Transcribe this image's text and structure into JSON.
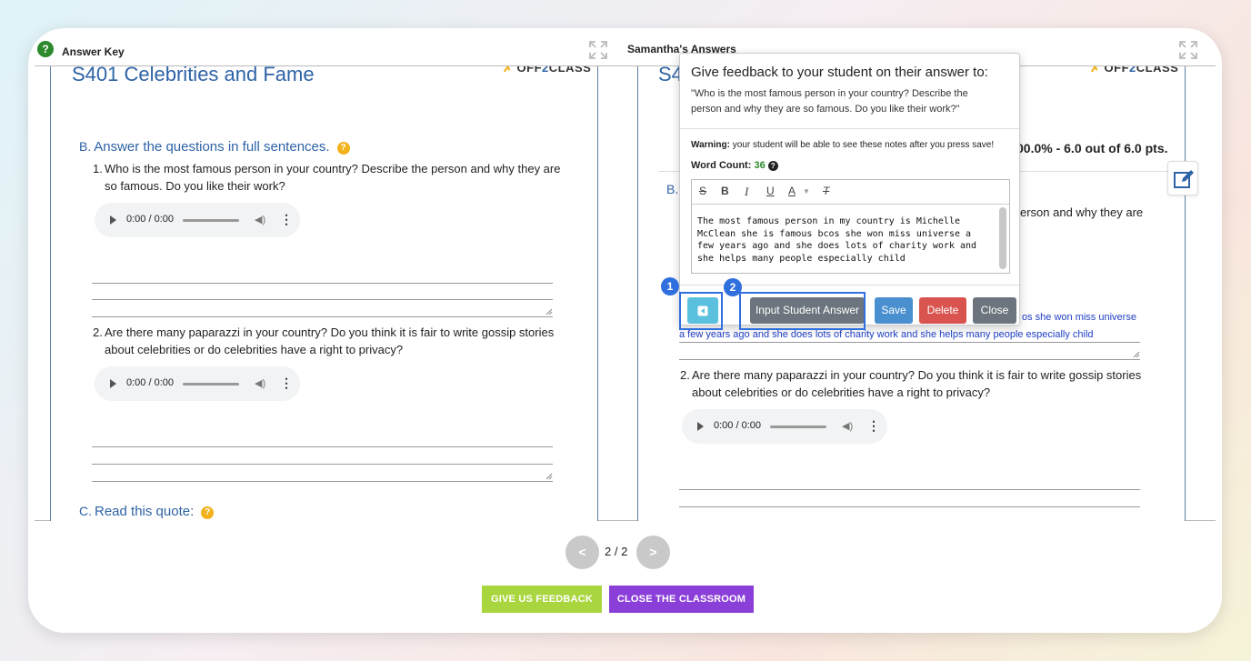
{
  "left_panel": {
    "header": "Answer Key",
    "help_icon": "?",
    "title": "S401 Celebrities and Fame",
    "logo": {
      "star": "✗",
      "text_a": "OFF",
      "text_b": "2",
      "text_c": "CLASS"
    },
    "section_b": {
      "letter": "B.",
      "label": "Answer the questions in full sentences.",
      "help": "?"
    },
    "q1": {
      "num": "1.",
      "line1": "Who is the most famous person in your country? Describe the person and why they are",
      "line2": "so famous. Do you like their work?"
    },
    "q2": {
      "num": "2.",
      "line1": "Are there many paparazzi in your country? Do you think it is fair to write gossip stories",
      "line2": "about celebrities or do celebrities have a right to privacy?"
    },
    "audio_time": "0:00 / 0:00",
    "section_c": {
      "letter": "C.",
      "label": "Read this quote:",
      "help": "?"
    }
  },
  "right_panel": {
    "header": "Samantha's Answers",
    "title_partial": "S4",
    "section_b_letter": "B.",
    "score": "00.0% - 6.0 out of 6.0 pts.",
    "q1_tail": "erson and why they are",
    "answer_line1": "os she won miss universe",
    "answer_line2": "a few years ago and she does lots of charity work and she helps many people especially child",
    "q2": {
      "num": "2.",
      "line1": "Are there many paparazzi in your country? Do you think it is fair to write gossip stories",
      "line2": "about celebrities or do celebrities have a right to privacy?"
    },
    "audio_time": "0:00 / 0:00"
  },
  "feedback_popup": {
    "title": "Give feedback to your student on their answer to:",
    "question": "\"Who is the most famous person in your country? Describe the person and why they are so famous. Do you like their work?\"",
    "warning_label": "Warning:",
    "warning_text": " your student will be able to see these notes after you press save!",
    "word_count_label": "Word Count: ",
    "word_count": "36",
    "word_count_help": "?",
    "toolbar": {
      "strike": "S",
      "bold": "B",
      "italic": "I",
      "underline": "U",
      "color": "A",
      "clear": "T"
    },
    "editor_text": "The most famous person in my country is Michelle McClean she is famous bcos she won miss universe a few years ago and she does lots of charity work and she helps many people especially child",
    "buttons": {
      "input": "Input Student Answer",
      "save": "Save",
      "delete": "Delete",
      "close": "Close"
    },
    "badges": [
      "1",
      "2"
    ]
  },
  "pagination": {
    "prev": "<",
    "next": ">",
    "text": "2 / 2"
  },
  "bottom": {
    "feedback": "GIVE US FEEDBACK",
    "close": "CLOSE THE CLASSROOM"
  },
  "colors": {
    "accent_blue": "#2e63a6",
    "feedback_green": "#a9d63e",
    "close_purple": "#8b3fd9"
  }
}
